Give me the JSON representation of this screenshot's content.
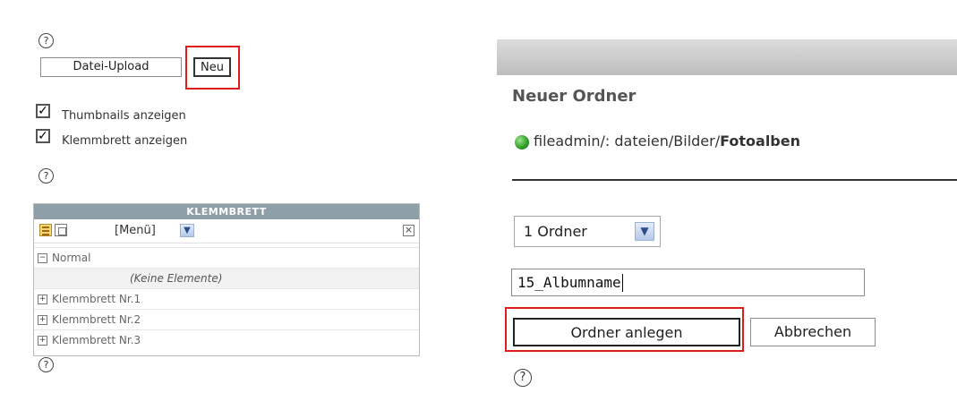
{
  "left_panel": {
    "help_symbol": "?",
    "upload_button_label": "Datei-Upload",
    "new_button_label": "Neu",
    "checkboxes": [
      {
        "label": "Thumbnails anzeigen",
        "checked": true,
        "mark": "✓"
      },
      {
        "label": "Klemmbrett anzeigen",
        "checked": true,
        "mark": "✓"
      }
    ],
    "clipboard": {
      "header": "KLEMMBRETT",
      "menu_select": "[Menü]",
      "close_symbol": "×",
      "rows": [
        {
          "tree": "−",
          "label": "Normal"
        },
        {
          "label": "(Keine Elemente)"
        },
        {
          "tree": "+",
          "label": "Klemmbrett Nr.1"
        },
        {
          "tree": "+",
          "label": "Klemmbrett Nr.2"
        },
        {
          "tree": "+",
          "label": "Klemmbrett Nr.3"
        }
      ]
    }
  },
  "right_panel": {
    "title": "Neuer Ordner",
    "path_prefix": "fileadmin/: dateien/Bilder/",
    "path_current": "Fotoalben",
    "folder_count_select": "1 Ordner",
    "folder_name_value": "15_Albumname",
    "create_button_label": "Ordner anlegen",
    "cancel_button_label": "Abbrechen",
    "help_symbol": "?"
  },
  "colors": {
    "highlight_frame": "#e01b1b",
    "clipboard_header_bg": "#8f9fa8",
    "select_arrow": "#2c4d8a"
  }
}
